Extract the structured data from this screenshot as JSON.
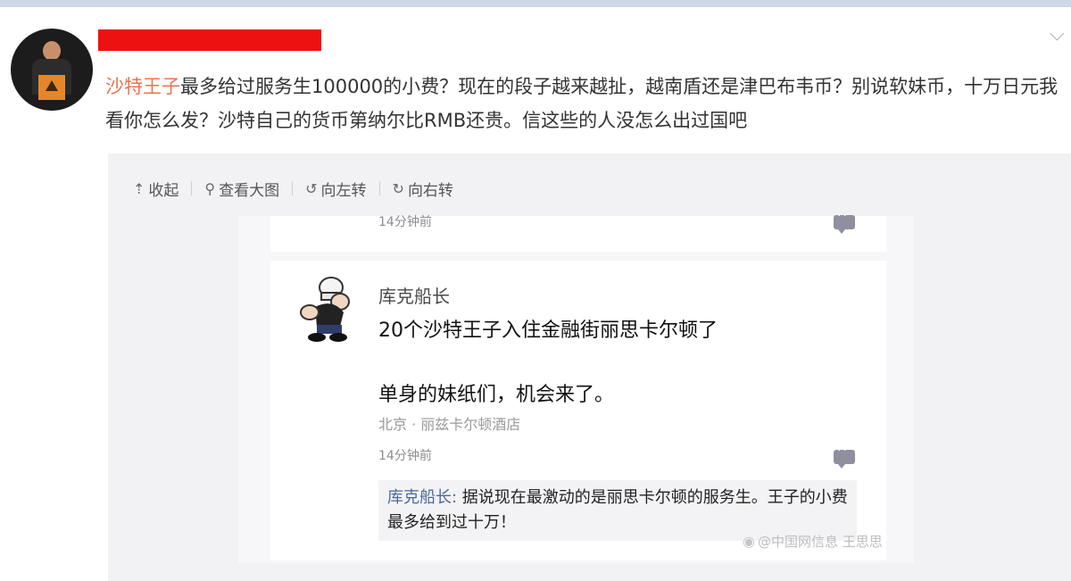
{
  "post": {
    "mention": "沙特王子",
    "text": "最多给过服务生100000的小费？现在的段子越来越扯，越南盾还是津巴布韦币？别说软妹币，十万日元我看你怎么发？沙特自己的货币第纳尔比RMB还贵。信这些的人没怎么出过国吧"
  },
  "header": {
    "more_icon": "chevron-down-icon"
  },
  "toolbar": {
    "collapse": "收起",
    "view_large": "查看大图",
    "rotate_left": "向左转",
    "rotate_right": "向右转"
  },
  "screenshot": {
    "top_time": "14分钟前",
    "username": "库克船长",
    "line1": "20个沙特王子入住金融街丽思卡尔顿了",
    "line2": "单身的妹纸们，机会来了。",
    "location": "北京 · 丽兹卡尔顿酒店",
    "time": "14分钟前",
    "reply_name": "库克船长:",
    "reply_text": " 据说现在最激动的是丽思卡尔顿的服务生。王子的小费最多给到过十万！",
    "watermark": "@中国网信息 王思思"
  },
  "colors": {
    "mention": "#eb7350",
    "redaction": "#ee1111",
    "media_bg": "#f2f2f5"
  }
}
